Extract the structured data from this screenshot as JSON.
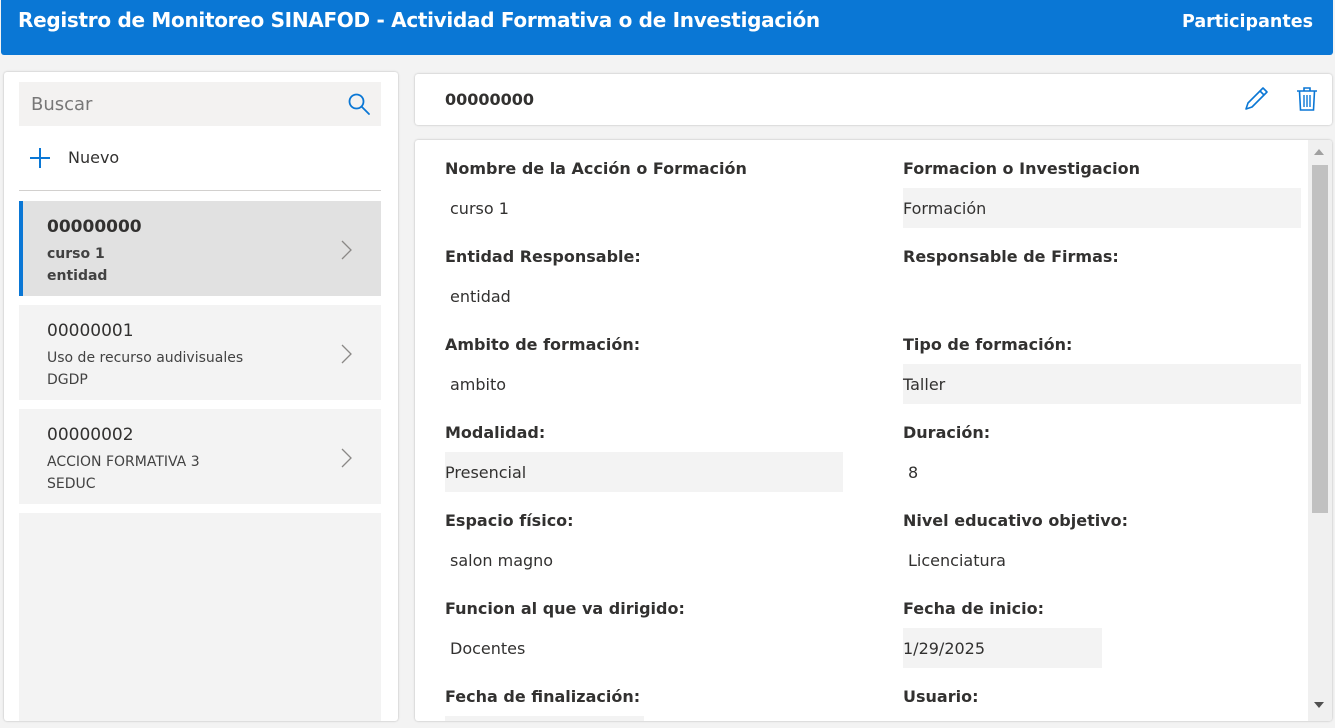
{
  "app": {
    "title": "Registro de Monitoreo SINAFOD - Actividad Formativa o de Investigación",
    "participants_link": "Participantes"
  },
  "sidebar": {
    "search_placeholder": "Buscar",
    "new_label": "Nuevo",
    "items": [
      {
        "code": "00000000",
        "name": "curso 1",
        "entity": "entidad"
      },
      {
        "code": "00000001",
        "name": "Uso de recurso audivisuales",
        "entity": "DGDP"
      },
      {
        "code": "00000002",
        "name": "ACCION FORMATIVA 3",
        "entity": "SEDUC"
      }
    ]
  },
  "detail": {
    "code": "00000000",
    "fields": {
      "nombre": {
        "label": "Nombre de la Acción o Formación",
        "value": "curso 1"
      },
      "formacion": {
        "label": "Formacion o Investigacion",
        "value": "Formación"
      },
      "entidad": {
        "label": "Entidad Responsable:",
        "value": "entidad"
      },
      "firmas": {
        "label": "Responsable de Firmas:",
        "value": ""
      },
      "ambito": {
        "label": "Ambito de formación:",
        "value": "ambito"
      },
      "tipo": {
        "label": "Tipo de formación:",
        "value": "Taller"
      },
      "modalidad": {
        "label": "Modalidad:",
        "value": "Presencial"
      },
      "duracion": {
        "label": "Duración:",
        "value": "8"
      },
      "espacio": {
        "label": "Espacio físico:",
        "value": "salon magno"
      },
      "nivel": {
        "label": "Nivel educativo objetivo:",
        "value": "Licenciatura"
      },
      "funcion": {
        "label": "Funcion al que va dirigido:",
        "value": "Docentes"
      },
      "inicio": {
        "label": "Fecha de inicio:",
        "value": "1/29/2025"
      },
      "fin": {
        "label": "Fecha de finalización:",
        "value": ""
      },
      "usuario": {
        "label": "Usuario:",
        "value": ""
      }
    }
  },
  "colors": {
    "accent": "#0a77d5",
    "selected_bg": "#e1e1e1",
    "item_bg": "#f3f3f3"
  },
  "icons": {
    "search": "search-icon",
    "new": "plus-icon",
    "chevron": "chevron-right-icon",
    "edit": "pencil-icon",
    "delete": "trash-icon"
  }
}
